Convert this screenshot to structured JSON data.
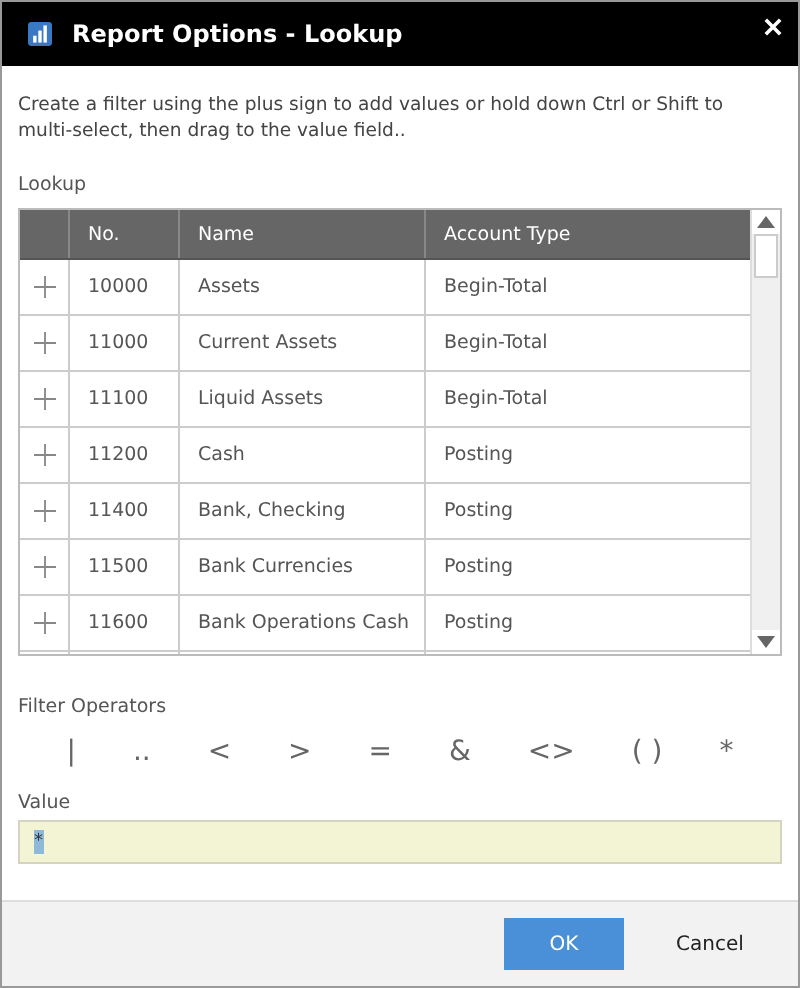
{
  "window": {
    "title": "Report Options - Lookup"
  },
  "description": "Create a filter using the plus sign to add values or hold down Ctrl or Shift to multi-select, then drag to the value field..",
  "lookup": {
    "label": "Lookup",
    "columns": [
      "No.",
      "Name",
      "Account Type"
    ],
    "rows": [
      {
        "no": "10000",
        "name": "Assets",
        "account_type": "Begin-Total"
      },
      {
        "no": "11000",
        "name": "Current Assets",
        "account_type": "Begin-Total"
      },
      {
        "no": "11100",
        "name": "Liquid Assets",
        "account_type": "Begin-Total"
      },
      {
        "no": "11200",
        "name": "Cash",
        "account_type": "Posting"
      },
      {
        "no": "11400",
        "name": "Bank, Checking",
        "account_type": "Posting"
      },
      {
        "no": "11500",
        "name": "Bank Currencies",
        "account_type": "Posting"
      },
      {
        "no": "11600",
        "name": "Bank Operations Cash",
        "account_type": "Posting"
      }
    ]
  },
  "filter_operators": {
    "label": "Filter Operators",
    "operators": [
      "|",
      "..",
      "<",
      ">",
      "=",
      "&",
      "<>",
      "( )",
      "*"
    ]
  },
  "value": {
    "label": "Value",
    "value": "*",
    "selected": true
  },
  "buttons": [
    {
      "label": "OK",
      "kind": "primary"
    },
    {
      "label": "Cancel",
      "kind": "plain"
    }
  ]
}
